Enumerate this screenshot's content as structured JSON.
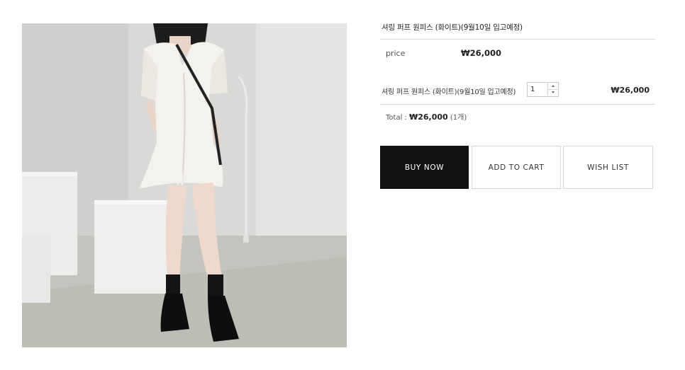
{
  "product": {
    "title": "셔링 퍼프 원피스 (화이트)(9월10일 입고예정)",
    "price_label": "price",
    "price_value": "₩26,000",
    "image_alt": "셔링 퍼프 원피스 (화이트)"
  },
  "option": {
    "name": "셔링 퍼프 원피스 (화이트)(9월10일 입고예정)",
    "quantity": "1",
    "price": "₩26,000"
  },
  "total": {
    "label": "Total : ",
    "amount": "₩26,000",
    "count": " (1개)"
  },
  "buttons": {
    "buy_now": "BUY NOW",
    "add_to_cart": "ADD TO CART",
    "wish_list": "WISH LIST"
  },
  "icons": {
    "qty_up": "caret-up-icon",
    "qty_down": "caret-down-icon"
  },
  "colors": {
    "buy_button_bg": "#111111",
    "divider": "#d9d9d9"
  }
}
